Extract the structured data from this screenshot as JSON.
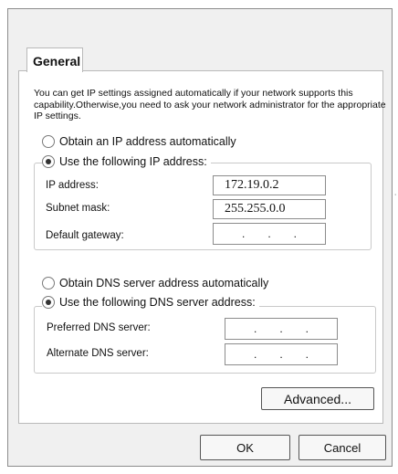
{
  "tab": {
    "label": "General"
  },
  "intro_text": "You can get IP settings assigned automatically if your network supports this capability.Otherwise,you need to ask your network administrator for the appropriate IP settings.",
  "ip": {
    "auto_label": "Obtain an IP address automatically",
    "auto_selected": false,
    "manual_label": "Use the following IP address:",
    "manual_selected": true,
    "fields": [
      {
        "label": "IP address:",
        "value": "172.19.0.2"
      },
      {
        "label": "Subnet mask:",
        "value": "255.255.0.0"
      },
      {
        "label": "Default gateway:",
        "value": ""
      }
    ]
  },
  "dns": {
    "auto_label": "Obtain DNS server address automatically",
    "auto_selected": false,
    "manual_label": "Use the following DNS server address:",
    "manual_selected": true,
    "fields": [
      {
        "label": "Preferred DNS server:",
        "value": ""
      },
      {
        "label": "Alternate DNS server:",
        "value": ""
      }
    ]
  },
  "buttons": {
    "advanced": "Advanced...",
    "ok": "OK",
    "cancel": "Cancel"
  },
  "empty_ip_separator": "."
}
